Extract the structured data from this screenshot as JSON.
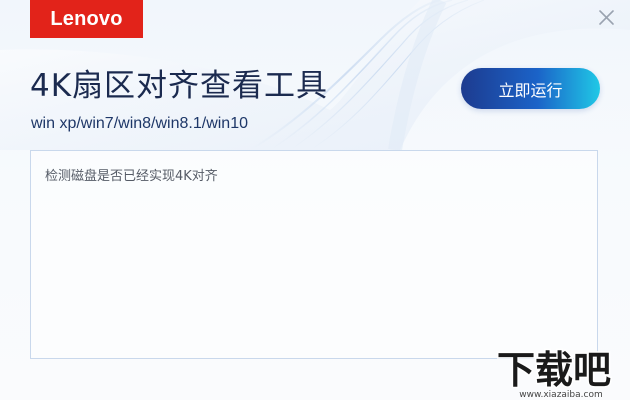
{
  "brand": {
    "logo_text": "Lenovo",
    "logo_color": "#e2231a"
  },
  "window": {
    "close_icon": "close-icon"
  },
  "header": {
    "title": "4K扇区对齐查看工具",
    "subtitle": "win xp/win7/win8/win8.1/win10",
    "run_button_label": "立即运行"
  },
  "log": {
    "text": "检测磁盘是否已经实现4K对齐"
  },
  "watermark": {
    "main_text": "下载吧",
    "url_text": "www.xiazaiba.com"
  },
  "colors": {
    "title": "#1b2a4f",
    "button_start": "#1d3b8f",
    "button_end": "#20c8e6"
  }
}
